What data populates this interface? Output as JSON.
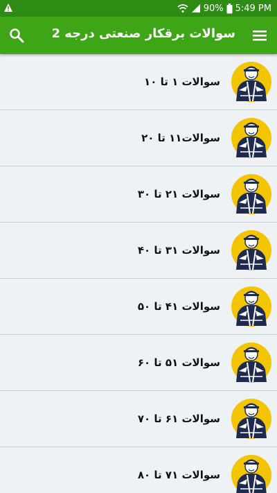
{
  "status_bar": {
    "battery": "90%",
    "time": "5:49 PM",
    "icons": [
      "warning-icon",
      "wifi-icon",
      "signal-icon",
      "battery-icon"
    ]
  },
  "app_bar": {
    "title": "سوالات برقکار صنعتی درجه 2",
    "icons": [
      "search-icon",
      "menu-icon"
    ]
  },
  "colors": {
    "app_bar": "#3ea616",
    "status_bar": "#2e8b14",
    "background": "#eef2f4",
    "avatar_yellow": "#f3c400"
  },
  "list": {
    "items": [
      {
        "label": "سوالات ۱ تا ۱۰"
      },
      {
        "label": "سوالات۱۱ تا ۲۰"
      },
      {
        "label": "سوالات ۲۱ تا ۳۰"
      },
      {
        "label": "سوالات ۳۱ تا ۴۰"
      },
      {
        "label": "سوالات ۴۱ تا ۵۰"
      },
      {
        "label": "سوالات ۵۱ تا ۶۰"
      },
      {
        "label": "سوالات ۶۱ تا ۷۰"
      },
      {
        "label": "سوالات ۷۱ تا ۸۰"
      }
    ]
  }
}
